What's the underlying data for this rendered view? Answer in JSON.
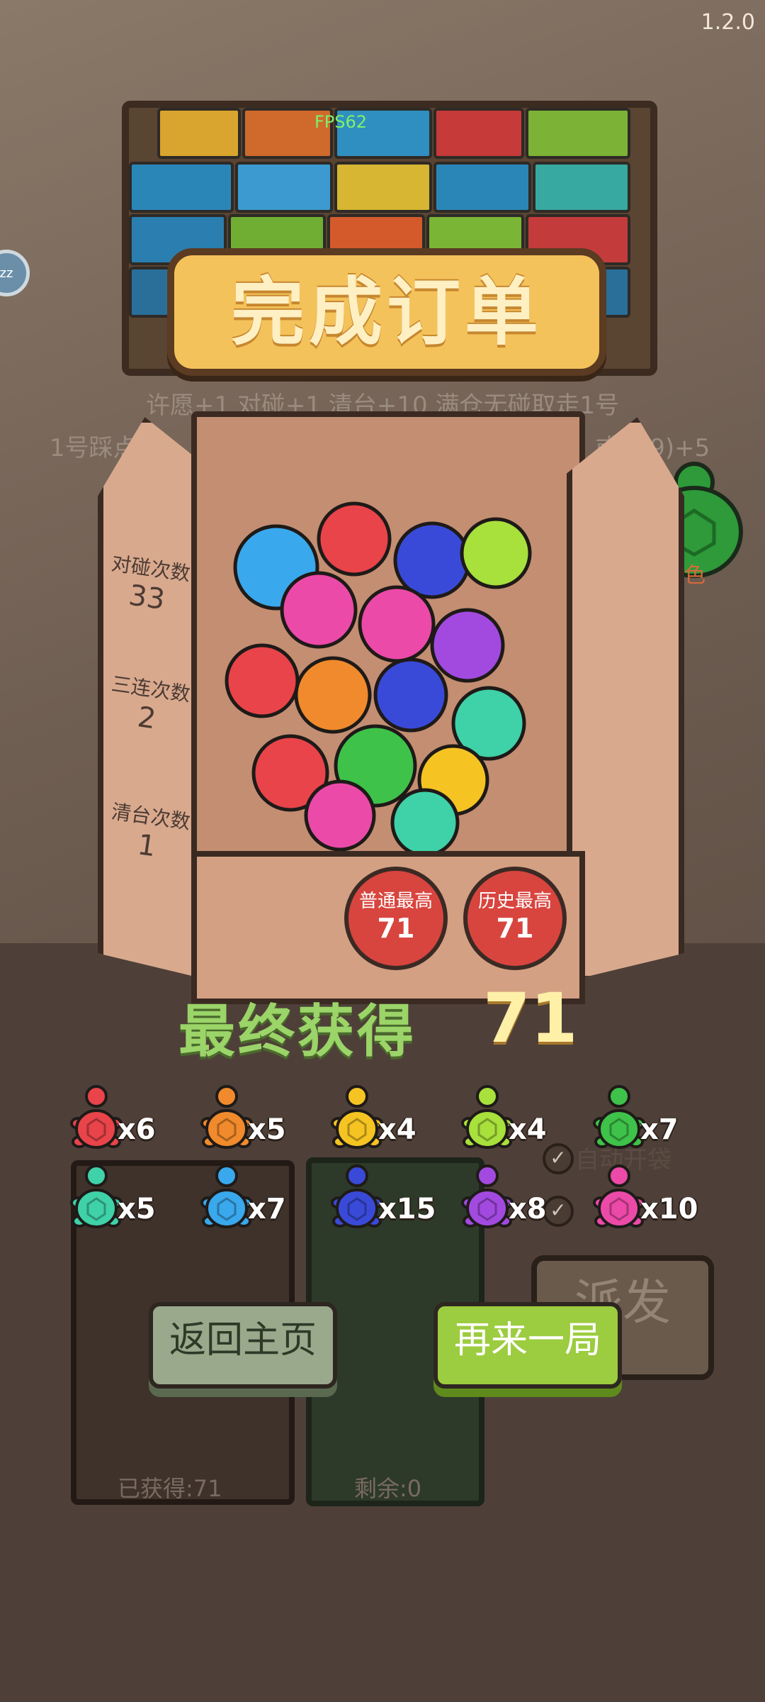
{
  "version": "1.2.0",
  "fps": "FPS62",
  "sleep_badge": "zz",
  "title": "完成订单",
  "rules_line1": "许愿+1 对碰+1 清台+10 满仓无碰取走1号",
  "rules_line2_left": "1号踩点",
  "rules_line2_right": "或789)+5",
  "lucky_label": "运色",
  "stats": [
    {
      "label": "对碰次数",
      "value": "33"
    },
    {
      "label": "三连次数",
      "value": "2"
    },
    {
      "label": "清台次数",
      "value": "1"
    }
  ],
  "seals": [
    {
      "label": "普通最高",
      "value": "71"
    },
    {
      "label": "历史最高",
      "value": "71"
    }
  ],
  "final_label": "最终获得",
  "final_value": "71",
  "rewards": [
    {
      "color": "#e8444a",
      "count": "x6"
    },
    {
      "color": "#f08a2c",
      "count": "x5"
    },
    {
      "color": "#f5c423",
      "count": "x4"
    },
    {
      "color": "#a8e03c",
      "count": "x4"
    },
    {
      "color": "#3ec24a",
      "count": "x7"
    },
    {
      "color": "#3fd1a8",
      "count": "x5"
    },
    {
      "color": "#3aa8ec",
      "count": "x7"
    },
    {
      "color": "#3a4ad8",
      "count": "x15"
    },
    {
      "color": "#a24ae0",
      "count": "x8"
    },
    {
      "color": "#ec4aa8",
      "count": "x10"
    }
  ],
  "auto_open_label": "自动开袋",
  "send_label": "派发",
  "obtained_label": "已获得:71",
  "remaining_label": "剩余:0",
  "home_button": "返回主页",
  "again_button": "再来一局",
  "colors": {
    "lucky": "#2e9a3a",
    "accent": "#9ccc3f"
  }
}
